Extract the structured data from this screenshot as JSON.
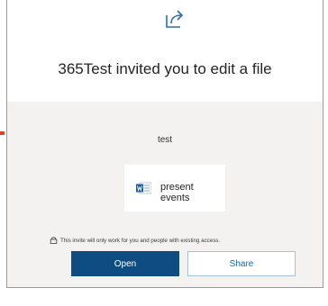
{
  "invite": {
    "title": "365Test invited you to edit a file",
    "message": "test",
    "file_name": "present events",
    "notice": "This invite will only work for you and people with existing access.",
    "open_label": "Open",
    "share_label": "Share"
  },
  "icons": {
    "header": "share-arrow-icon",
    "file": "word-file-icon",
    "notice": "lock-icon"
  },
  "colors": {
    "primary_button": "#0f4c81",
    "share_text": "#0f6cbd",
    "icon_blue": "#1f5ca7",
    "body_background": "#f3f2f1"
  }
}
